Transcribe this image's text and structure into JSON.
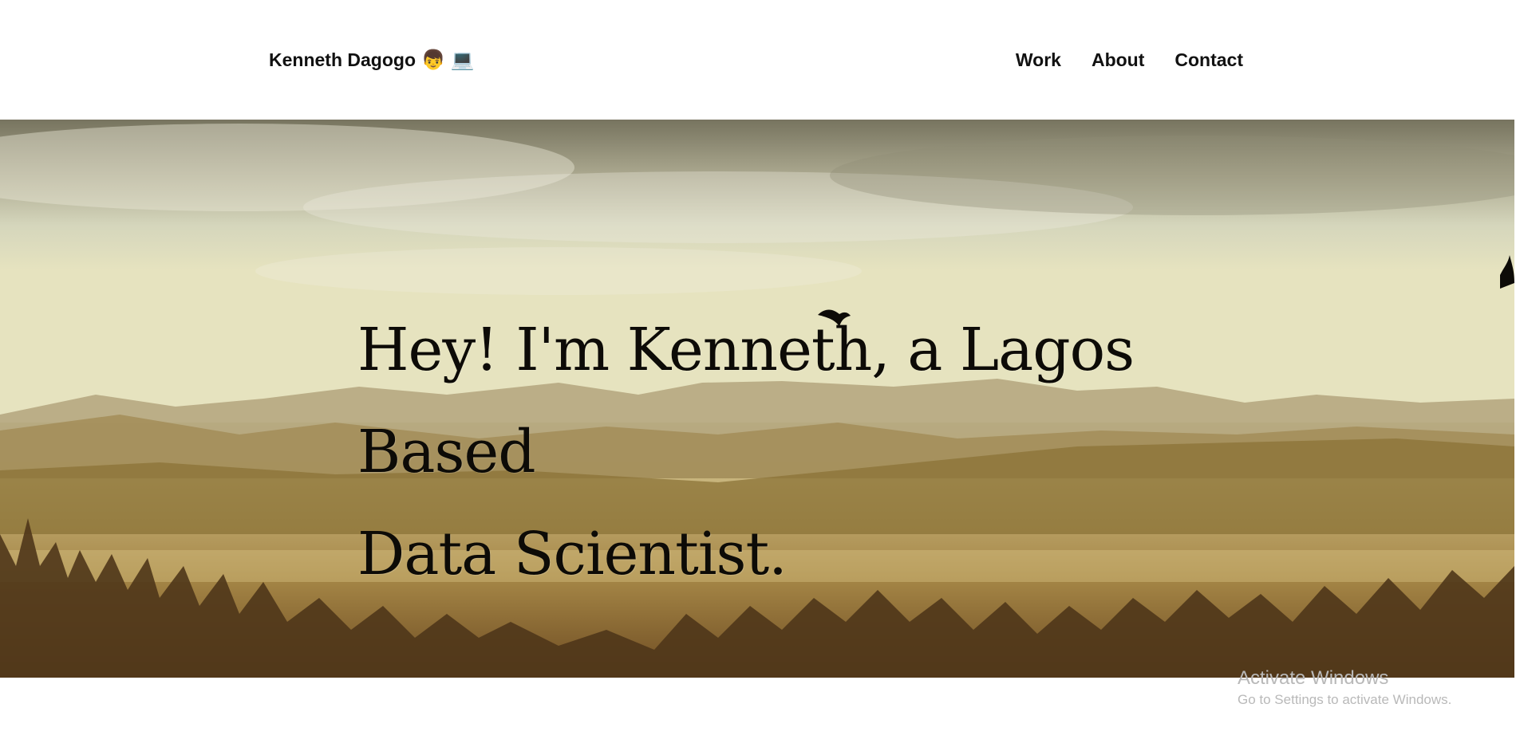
{
  "header": {
    "brand_name": "Kenneth Dagogo",
    "brand_emoji_person": "👦",
    "brand_emoji_laptop": "💻",
    "nav": [
      {
        "label": "Work"
      },
      {
        "label": "About"
      },
      {
        "label": "Contact"
      }
    ]
  },
  "hero": {
    "title_line1": "Hey! I'm Kenneth, a Lagos Based",
    "title_line2": "Data Scientist."
  },
  "watermark": {
    "title": "Activate Windows",
    "subtitle": "Go to Settings to activate Windows."
  },
  "colors": {
    "text": "#111111",
    "hero_text": "#0d0b07",
    "watermark": "#b9b9b9"
  }
}
